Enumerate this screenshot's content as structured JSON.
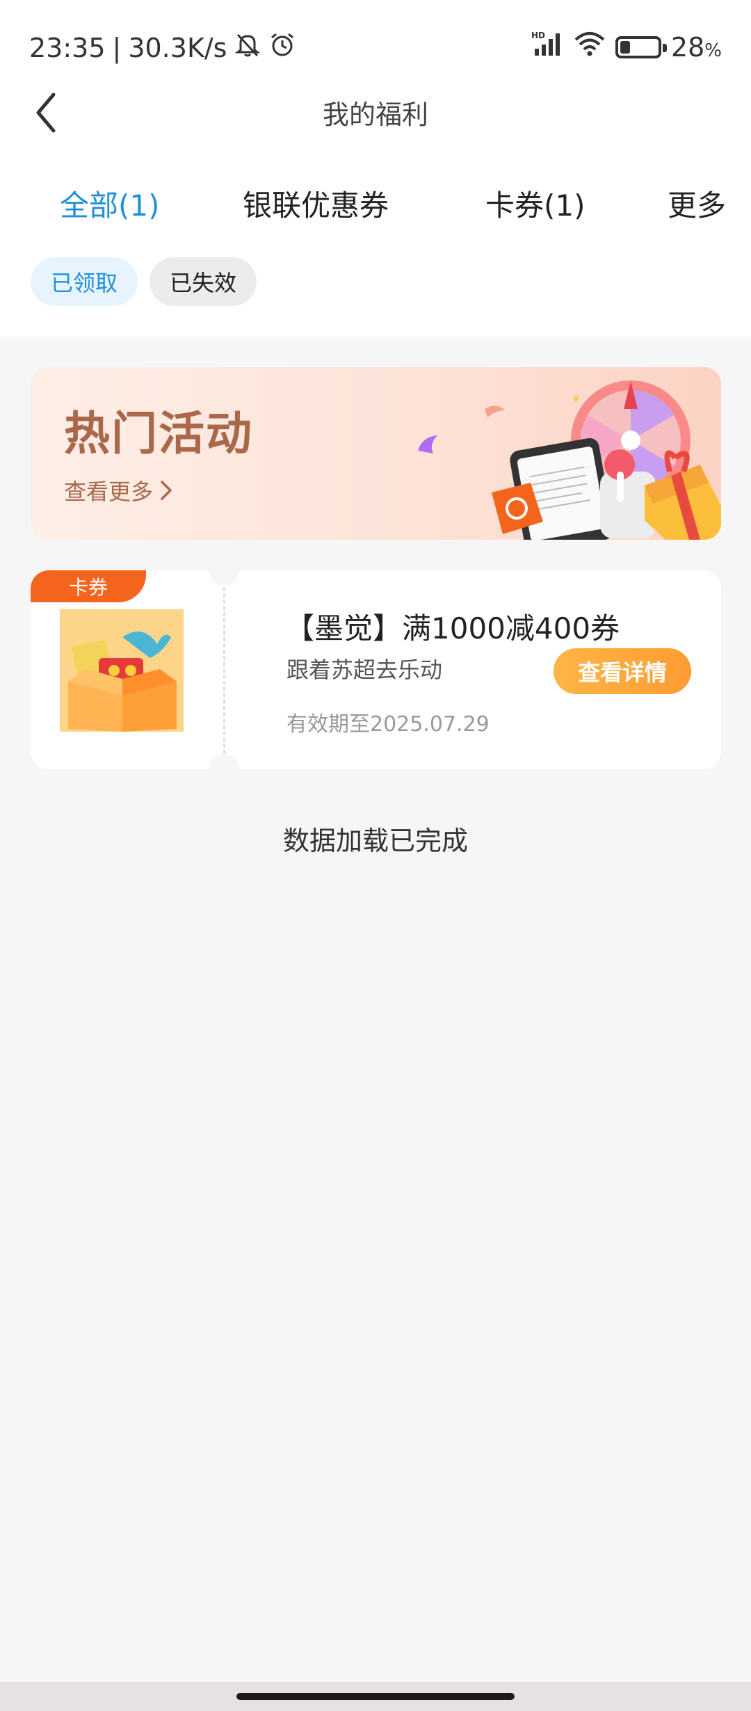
{
  "status_bar": {
    "time": "23:35",
    "separator": "|",
    "net_speed": "30.3K/s",
    "signal_badge": "HD",
    "battery_percent": "28",
    "percent_sign": "%",
    "icons": [
      "mute-bell-icon",
      "alarm-icon",
      "signal-icon",
      "wifi-icon",
      "battery-icon"
    ]
  },
  "header": {
    "back_icon": "chevron-left-icon",
    "title": "我的福利"
  },
  "tabs": [
    {
      "label": "全部(1)",
      "active": true
    },
    {
      "label": "银联优惠券",
      "active": false
    },
    {
      "label": "卡券(1)",
      "active": false
    },
    {
      "label": "更多",
      "active": false
    }
  ],
  "filters": [
    {
      "label": "已领取",
      "active": true
    },
    {
      "label": "已失效",
      "active": false
    }
  ],
  "banner": {
    "title": "热门活动",
    "more_label": "查看更多"
  },
  "coupon": {
    "tag": "卡券",
    "title": "【墨觉】满1000减400券",
    "subtitle": "跟着苏超去乐动",
    "expire": "有效期至2025.07.29",
    "button_label": "查看详情"
  },
  "footer_text": "数据加载已完成",
  "colors": {
    "accent_blue": "#1f8fdc",
    "tag_orange": "#f4641c",
    "button_orange": "#ffa63c",
    "banner_brown": "#a9684a"
  }
}
